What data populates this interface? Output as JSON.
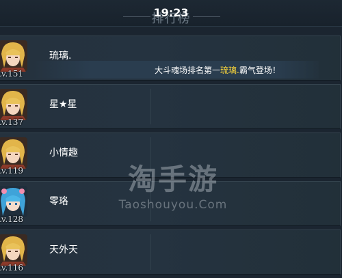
{
  "clock": "19:23",
  "title": "排行榜",
  "entries": [
    {
      "name": "琉璃.",
      "level": "Lv.151",
      "avatar": "blonde-warrior-avatar"
    },
    {
      "name": "星★星",
      "level": "Lv.137",
      "avatar": "blonde-warrior-avatar"
    },
    {
      "name": "小情趣",
      "level": "Lv.119",
      "avatar": "blonde-warrior-avatar"
    },
    {
      "name": "零珞",
      "level": "Lv.128",
      "avatar": "blue-haired-girl-avatar"
    },
    {
      "name": "天外天",
      "level": "Lv.116",
      "avatar": "blonde-warrior-avatar"
    }
  ],
  "announcement": {
    "prefix": "大斗魂场排名第一",
    "highlight": "琉璃.",
    "suffix": "霸气登场！"
  },
  "watermark": {
    "logo": "淘手游",
    "sub": "Taoshouyou.Com"
  },
  "colors": {
    "highlight": "#ffd93a",
    "row_bg": "#25323e",
    "page_bg": "#1b2530"
  }
}
